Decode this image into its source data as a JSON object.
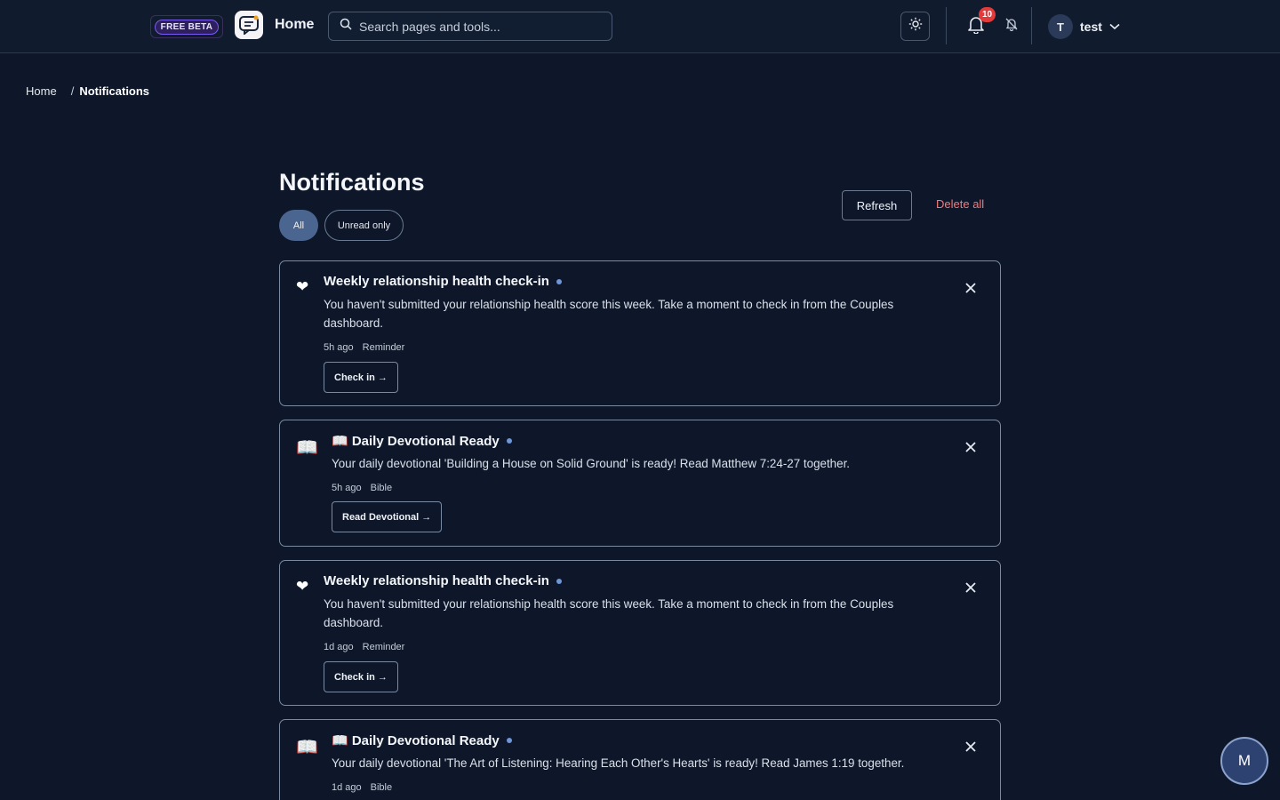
{
  "header": {
    "beta_label": "FREE BETA",
    "home_label": "Home",
    "search_placeholder": "Search pages and tools...",
    "notification_count": "10",
    "user_initial": "T",
    "user_name": "test"
  },
  "breadcrumb": {
    "home": "Home",
    "separator": "/",
    "current": "Notifications"
  },
  "page": {
    "title": "Notifications",
    "filters": {
      "all": "All",
      "unread": "Unread only"
    },
    "refresh_label": "Refresh",
    "delete_all_label": "Delete all"
  },
  "notifications": [
    {
      "icon": "heart-icon",
      "title": "Weekly relationship health check-in",
      "body": "You haven't submitted your relationship health score this week. Take a moment to check in from the Couples dashboard.",
      "time": "5h ago",
      "category": "Reminder",
      "action": "Check in →",
      "unread": true
    },
    {
      "icon": "book-icon",
      "title": "📖 Daily Devotional Ready",
      "body": "Your daily devotional 'Building a House on Solid Ground' is ready! Read Matthew 7:24-27 together.",
      "time": "5h ago",
      "category": "Bible",
      "action": "Read Devotional →",
      "unread": true
    },
    {
      "icon": "heart-icon",
      "title": "Weekly relationship health check-in",
      "body": "You haven't submitted your relationship health score this week. Take a moment to check in from the Couples dashboard.",
      "time": "1d ago",
      "category": "Reminder",
      "action": "Check in →",
      "unread": true
    },
    {
      "icon": "book-icon",
      "title": "📖 Daily Devotional Ready",
      "body": "Your daily devotional 'The Art of Listening: Hearing Each Other's Hearts' is ready! Read James 1:19 together.",
      "time": "1d ago",
      "category": "Bible",
      "unread": true
    }
  ],
  "fab_label": "M",
  "colors": {
    "background": "#0d1729",
    "unread_dot": "#6f96d8",
    "delete": "#f47a7a",
    "badge": "#e23b3b"
  }
}
